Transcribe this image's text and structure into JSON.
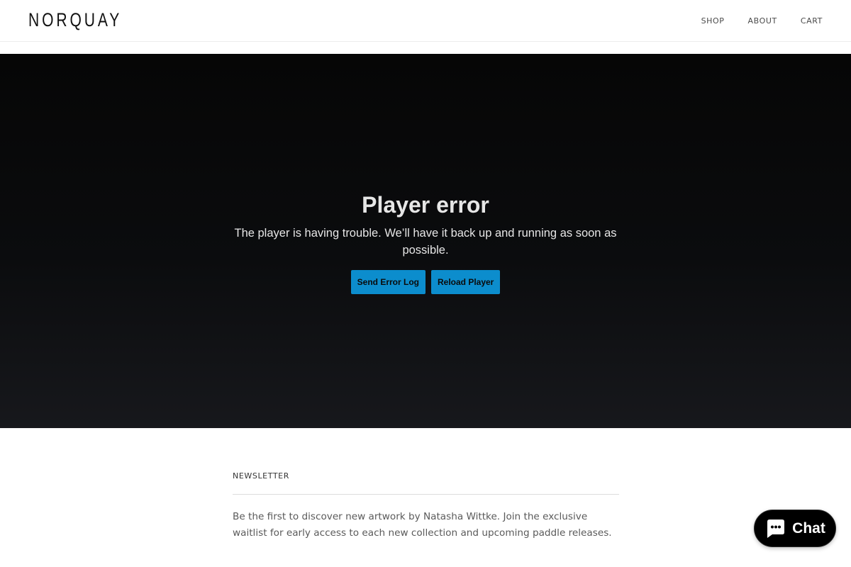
{
  "header": {
    "logo_text": "NORQUAY",
    "nav": [
      {
        "label": "SHOP"
      },
      {
        "label": "ABOUT"
      },
      {
        "label": "CART"
      }
    ]
  },
  "player": {
    "title": "Player error",
    "message": "The player is having trouble. We’ll have it back up and running as soon as possible.",
    "send_log_label": "Send Error Log",
    "reload_label": "Reload Player",
    "button_color": "#0c8dcd"
  },
  "newsletter": {
    "heading": "NEWSLETTER",
    "text": "Be the first to discover new artwork by Natasha Wittke. Join the exclusive waitlist for early access to each new collection and upcoming paddle releases."
  },
  "chat": {
    "label": "Chat",
    "icon": "chat-bubble-icon"
  }
}
